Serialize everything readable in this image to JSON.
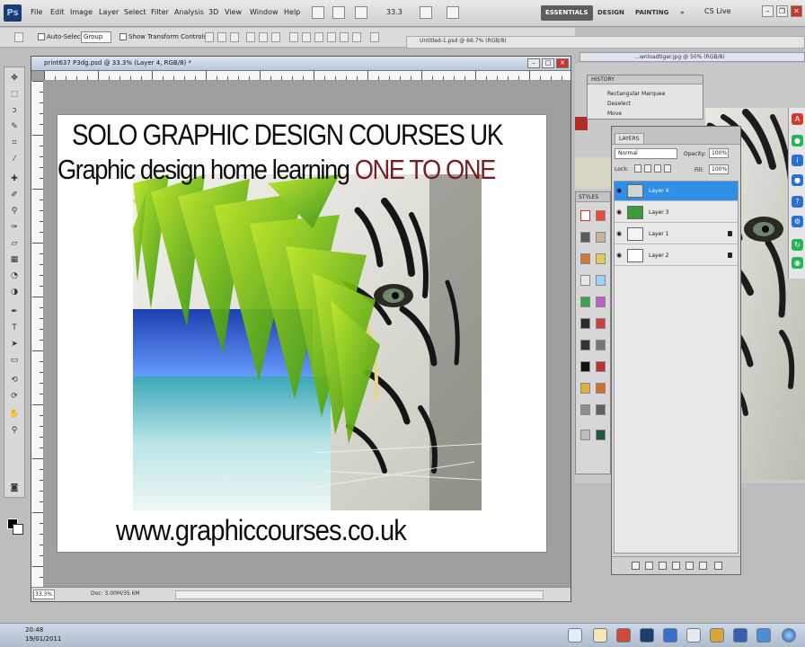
{
  "menu": {
    "logo": "Ps",
    "items": [
      "File",
      "Edit",
      "Image",
      "Layer",
      "Select",
      "Filter",
      "Analysis",
      "3D",
      "View",
      "Window",
      "Help"
    ],
    "zoom": "33.3",
    "workspaces": [
      "ESSENTIALS",
      "DESIGN",
      "PAINTING"
    ],
    "more": "»",
    "cs_live": "CS Live"
  },
  "options_bar": {
    "auto_select_label": "Auto-Select:",
    "auto_select_value": "Group",
    "transform_label": "Show Transform Controls"
  },
  "tabs": {
    "tab1": "Untitled-1.psd @ 66.7% (RGB/8)",
    "tab2": "…wnloadtiger.jpg @ 50% (RGB/8)"
  },
  "document": {
    "title": "print637 P3dg.psd @ 33.3% (Layer 4, RGB/8) *",
    "heading1": "SOLO GRAPHIC DESIGN COURSES   UK",
    "heading2_main": "Graphic design home learning ",
    "heading2_accent": "ONE TO ONE",
    "website": "www.graphiccourses.co.uk",
    "zoom": "33.3%",
    "status_info": "Doc: 3.00M/35.6M"
  },
  "history": {
    "title": "HISTORY",
    "items": [
      "Rectangular Marquee",
      "Deselect",
      "Move"
    ]
  },
  "styles_panel": {
    "title": "STYLES"
  },
  "layers_panel": {
    "tab": "LAYERS",
    "blend_mode": "Normal",
    "opacity_label": "Opacity:",
    "opacity_value": "100%",
    "fill_label": "Fill:",
    "fill_value": "100%",
    "lock_label": "Lock:",
    "layers": [
      {
        "name": "Layer 4",
        "selected": true,
        "locked": false
      },
      {
        "name": "Layer 3",
        "selected": false,
        "locked": false
      },
      {
        "name": "Layer 1",
        "selected": false,
        "locked": true
      },
      {
        "name": "Layer 2",
        "selected": false,
        "locked": true
      }
    ]
  },
  "taskbar": {
    "time": "20:48",
    "date": "19/01/2011"
  },
  "colors": {
    "accent_text": "#7a1c22",
    "selected_layer": "#2f8ee5",
    "titlebar": "#b9c9dc"
  }
}
